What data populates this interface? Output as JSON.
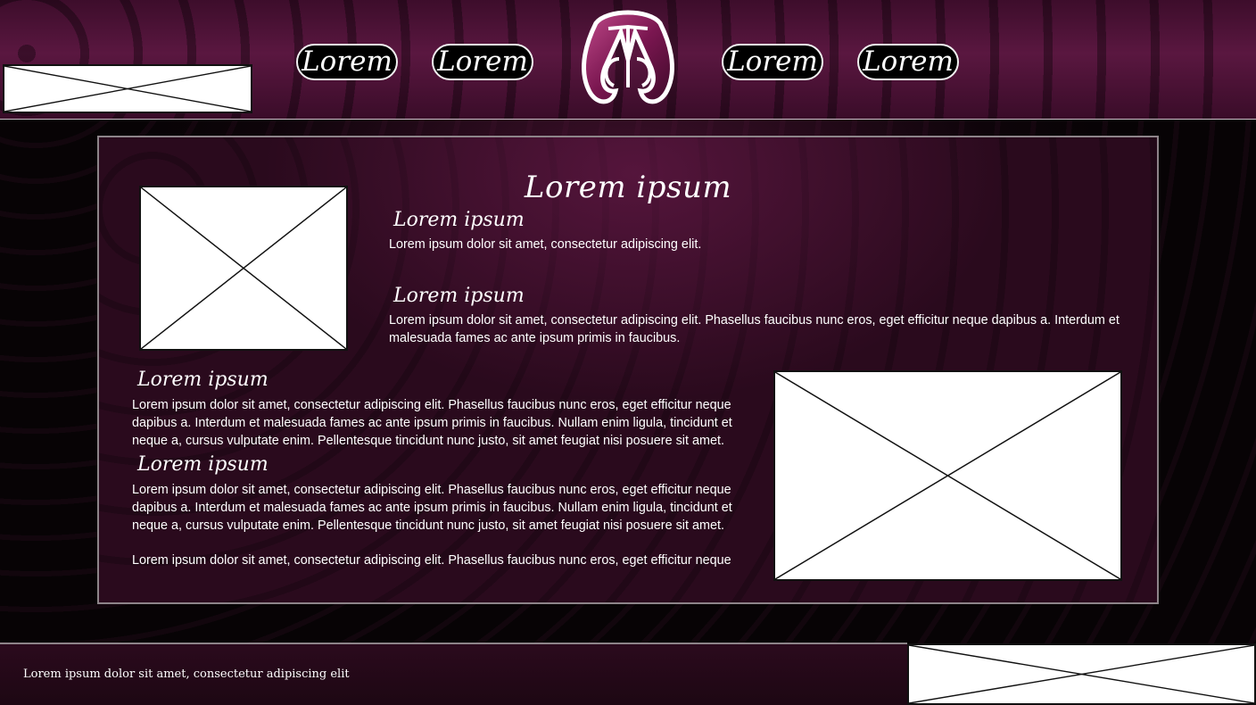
{
  "header": {
    "nav": [
      {
        "label": "Lorem"
      },
      {
        "label": "Lorem"
      },
      {
        "label": "Lorem"
      },
      {
        "label": "Lorem"
      }
    ],
    "logo": {
      "letters": "AR",
      "colors": {
        "primary": "#8a1d5a",
        "outline": "#ffffff"
      }
    }
  },
  "main": {
    "title": "Lorem ipsum",
    "sections": [
      {
        "heading": "Lorem ipsum",
        "text": "Lorem ipsum dolor sit amet, consectetur adipiscing elit."
      },
      {
        "heading": "Lorem ipsum",
        "text": "Lorem ipsum dolor sit amet, consectetur adipiscing elit. Phasellus faucibus nunc eros, eget efficitur neque dapibus a. Interdum et malesuada fames ac ante ipsum primis in faucibus."
      },
      {
        "heading": "Lorem ipsum",
        "text": "Lorem ipsum dolor sit amet, consectetur adipiscing elit. Phasellus faucibus nunc eros, eget efficitur neque dapibus a. Interdum et malesuada fames ac ante ipsum primis in faucibus. Nullam enim ligula, tincidunt et neque a, cursus vulputate enim. Pellentesque tincidunt nunc justo, sit amet feugiat nisi posuere sit amet."
      },
      {
        "heading": "Lorem ipsum",
        "text": "Lorem ipsum dolor sit amet, consectetur adipiscing elit. Phasellus faucibus nunc eros, eget efficitur neque dapibus a. Interdum et malesuada fames ac ante ipsum primis in faucibus. Nullam enim ligula, tincidunt et neque a, cursus vulputate enim. Pellentesque tincidunt nunc justo, sit amet feugiat nisi posuere sit amet."
      }
    ],
    "extra_text": "Lorem ipsum dolor sit amet, consectetur adipiscing elit. Phasellus faucibus nunc eros, eget efficitur neque"
  },
  "footer": {
    "text": "Lorem ipsum dolor sit amet, consectetur adipiscing elit"
  },
  "colors": {
    "background": "#070305",
    "accent": "#5a1740",
    "panel": "#2a0a1d",
    "text": "#ffffff"
  }
}
